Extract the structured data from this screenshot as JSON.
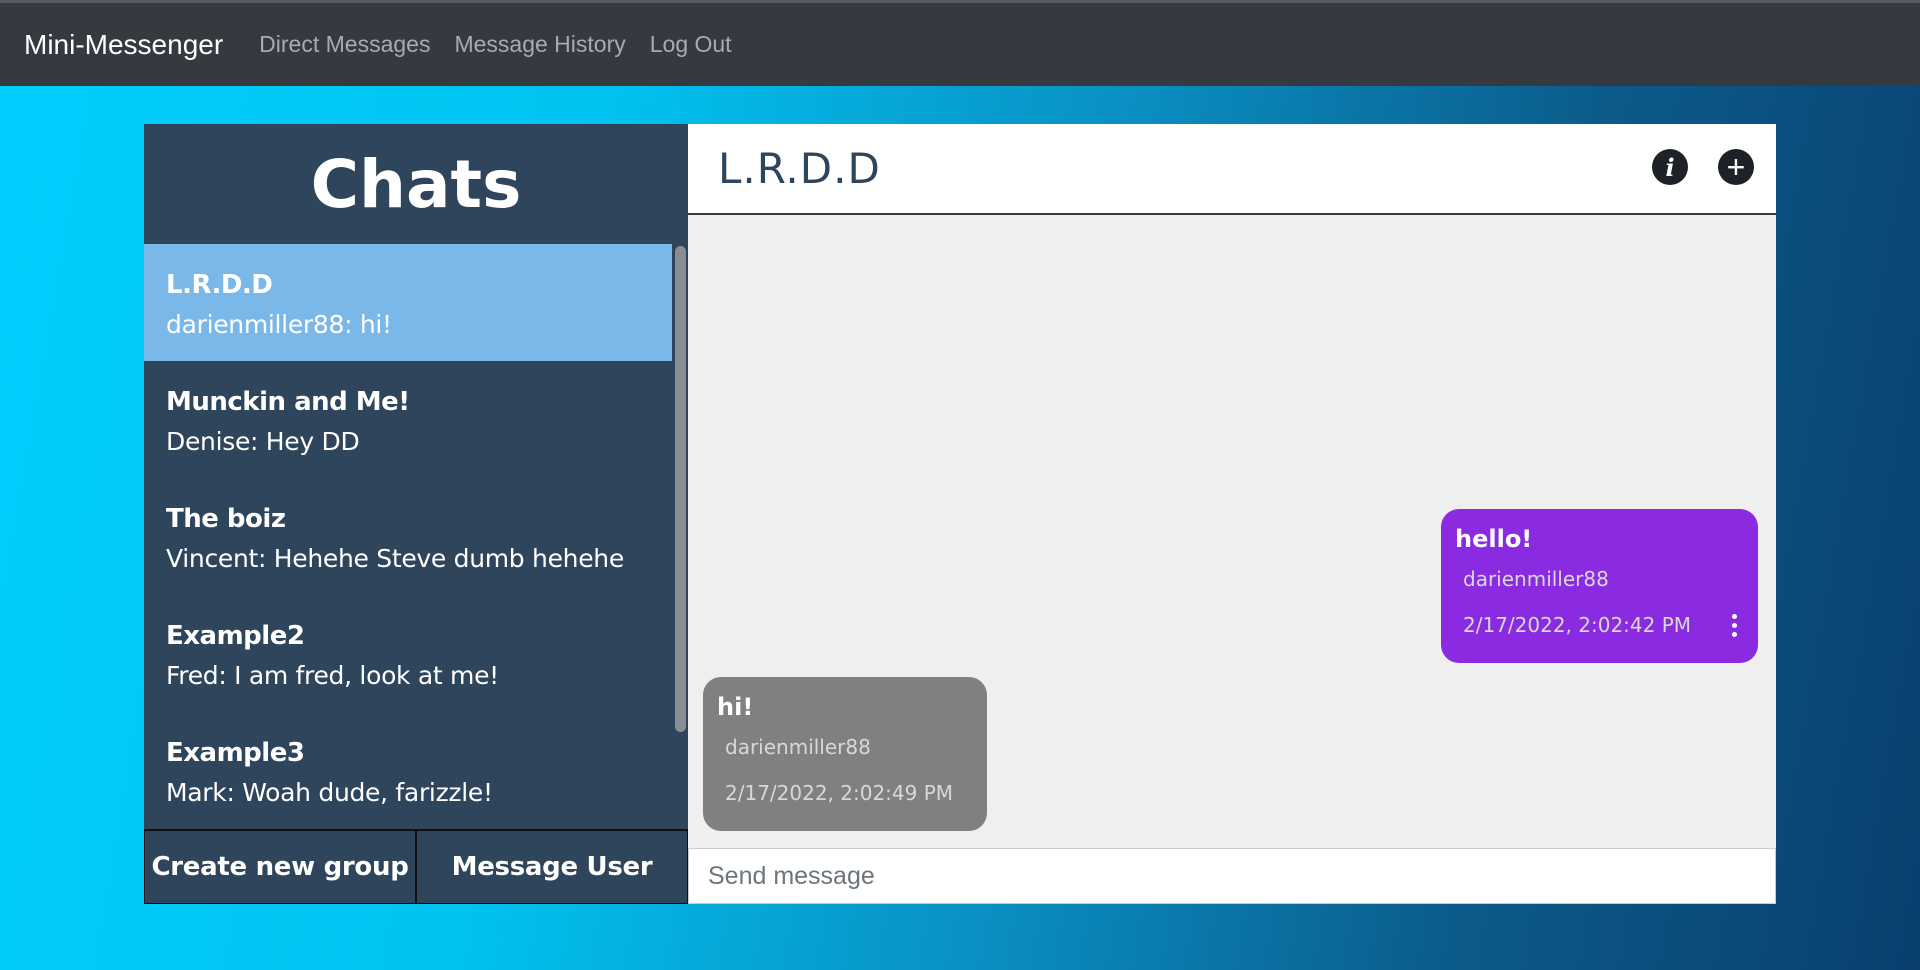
{
  "navbar": {
    "brand": "Mini-Messenger",
    "links": [
      "Direct Messages",
      "Message History",
      "Log Out"
    ]
  },
  "sidebar": {
    "title": "Chats",
    "chats": [
      {
        "name": "L.R.D.D",
        "preview": "darienmiller88: hi!",
        "active": true
      },
      {
        "name": "Munckin and Me!",
        "preview": "Denise: Hey DD"
      },
      {
        "name": "The boiz",
        "preview": "Vincent: Hehehe Steve dumb hehehe"
      },
      {
        "name": "Example2",
        "preview": "Fred: I am fred, look at me!"
      },
      {
        "name": "Example3",
        "preview": "Mark: Woah dude, farizzle!"
      }
    ],
    "create_group_label": "Create new group",
    "message_user_label": "Message User"
  },
  "conversation": {
    "title": "L.R.D.D",
    "info_icon": "info-icon",
    "add_icon": "plus-icon",
    "messages": [
      {
        "text": "hello!",
        "sender": "darienmiller88",
        "time": "2/17/2022, 2:02:42 PM",
        "direction": "sent",
        "color": "#8a2be2"
      },
      {
        "text": "hi!",
        "sender": "darienmiller88",
        "time": "2/17/2022, 2:02:49 PM",
        "direction": "received",
        "color": "#808080"
      }
    ],
    "input_placeholder": "Send message"
  },
  "colors": {
    "navbar": "#343a40",
    "sidebar": "#2f455c",
    "active_chat": "#7bb8ea",
    "sent_bubble": "#8a2be2",
    "received_bubble": "#808080"
  }
}
